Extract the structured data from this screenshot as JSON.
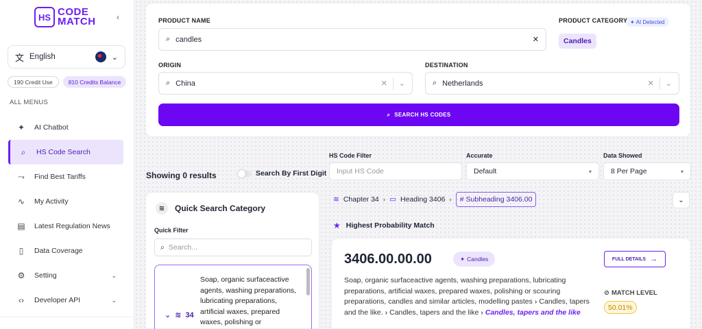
{
  "brand": {
    "badge": "HS",
    "line1": "CODE",
    "line2": "MATCH"
  },
  "language": {
    "label": "English"
  },
  "credits": {
    "used": "190 Credit Use",
    "balance": "810 Credits Balance"
  },
  "menu": {
    "heading": "ALL MENUS",
    "items": [
      {
        "label": "AI Chatbot",
        "icon": "sparkles-icon",
        "glyph": "✦"
      },
      {
        "label": "HS Code Search",
        "icon": "search-icon",
        "glyph": "⌕"
      },
      {
        "label": "Find Best Tariffs",
        "icon": "trend-icon",
        "glyph": "⤳"
      },
      {
        "label": "My Activity",
        "icon": "activity-icon",
        "glyph": "∿"
      },
      {
        "label": "Latest Regulation News",
        "icon": "news-icon",
        "glyph": "▤"
      },
      {
        "label": "Data Coverage",
        "icon": "document-icon",
        "glyph": "▯"
      },
      {
        "label": "Setting",
        "icon": "gear-icon",
        "glyph": "⚙"
      },
      {
        "label": "Developer API",
        "icon": "code-icon",
        "glyph": "‹›"
      }
    ]
  },
  "form": {
    "product_name_label": "PRODUCT NAME",
    "product_name_value": "candles",
    "product_category_label": "PRODUCT CATEGORY",
    "ai_badge": "AI Detected",
    "category_value": "Candles",
    "origin_label": "ORIGIN",
    "origin_value": "China",
    "destination_label": "DESTINATION",
    "destination_value": "Netherlands",
    "search_button": "SEARCH HS CODES"
  },
  "results": {
    "count_text": "Showing 0 results",
    "toggle_label": "Search By First Digit",
    "hs_filter_label": "HS Code Filter",
    "hs_filter_placeholder": "Input HS Code",
    "accurate_label": "Accurate",
    "accurate_value": "Default",
    "data_showed_label": "Data Showed",
    "data_showed_value": "8 Per Page"
  },
  "quick_search": {
    "title": "Quick Search Category",
    "filter_label": "Quick Filter",
    "search_placeholder": "Search...",
    "item_code": "34",
    "item_desc": "Soap, organic surfaceactive agents, washing preparations, lubricating preparations, artificial waxes, prepared waxes, polishing or"
  },
  "breadcrumb": {
    "chapter": "Chapter 34",
    "heading": "Heading 3406",
    "subheading": "# Subheading 3406.00"
  },
  "match": {
    "section_label": "Highest Probability Match",
    "code": "3406.00.00.00",
    "chip": "Candles",
    "desc_1": "Soap, organic surfaceactive agents, washing preparations, lubricating preparations, artificial waxes, prepared waxes, polishing or scouring preparations, candles and similar articles, modelling pastes",
    "desc_2": "Candles, tapers and the like.",
    "desc_3": "Candles, tapers and the like",
    "desc_4": "Candles, tapers and the like",
    "full_details": "FULL DETAILS",
    "match_level_label": "MATCH LEVEL",
    "match_level_value": "50.01%"
  },
  "colors": {
    "accent": "#6c06f3",
    "accent_soft": "#ece4fd"
  }
}
